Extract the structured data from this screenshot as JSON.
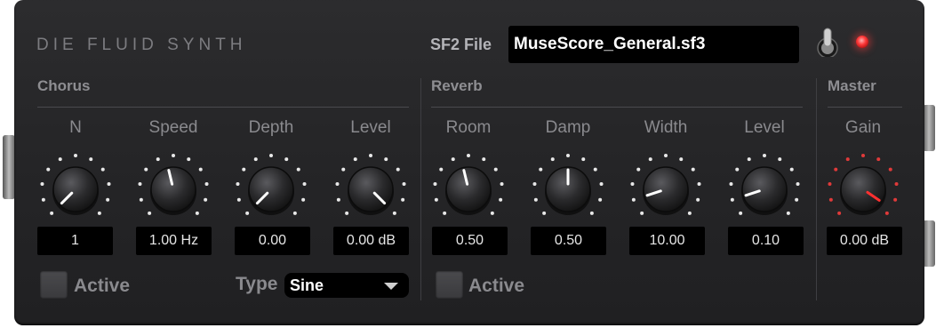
{
  "title": "DIE FLUID SYNTH",
  "sf2": {
    "label": "SF2 File",
    "value": "MuseScore_General.sf3"
  },
  "colors": {
    "panel": "#262628",
    "dots": "#e8e8e8",
    "gain_dots": "#e03a3a",
    "indicator": "#ffffff",
    "gain_indicator": "#ff3030",
    "led": "#ff3a3a"
  },
  "chorus": {
    "label": "Chorus",
    "knobs": [
      {
        "label": "N",
        "value": "1",
        "level": 0.0
      },
      {
        "label": "Speed",
        "value": "1.00 Hz",
        "level": 0.45
      },
      {
        "label": "Depth",
        "value": "0.00",
        "level": 0.0
      },
      {
        "label": "Level",
        "value": "0.00 dB",
        "level": 1.0
      }
    ],
    "active_label": "Active",
    "type_label": "Type",
    "type_value": "Sine"
  },
  "reverb": {
    "label": "Reverb",
    "knobs": [
      {
        "label": "Room",
        "value": "0.50",
        "level": 0.45
      },
      {
        "label": "Damp",
        "value": "0.50",
        "level": 0.5
      },
      {
        "label": "Width",
        "value": "10.00",
        "level": 0.1
      },
      {
        "label": "Level",
        "value": "0.10",
        "level": 0.1
      }
    ],
    "active_label": "Active"
  },
  "master": {
    "label": "Master",
    "knobs": [
      {
        "label": "Gain",
        "value": "0.00 dB",
        "level": 0.96
      }
    ]
  }
}
